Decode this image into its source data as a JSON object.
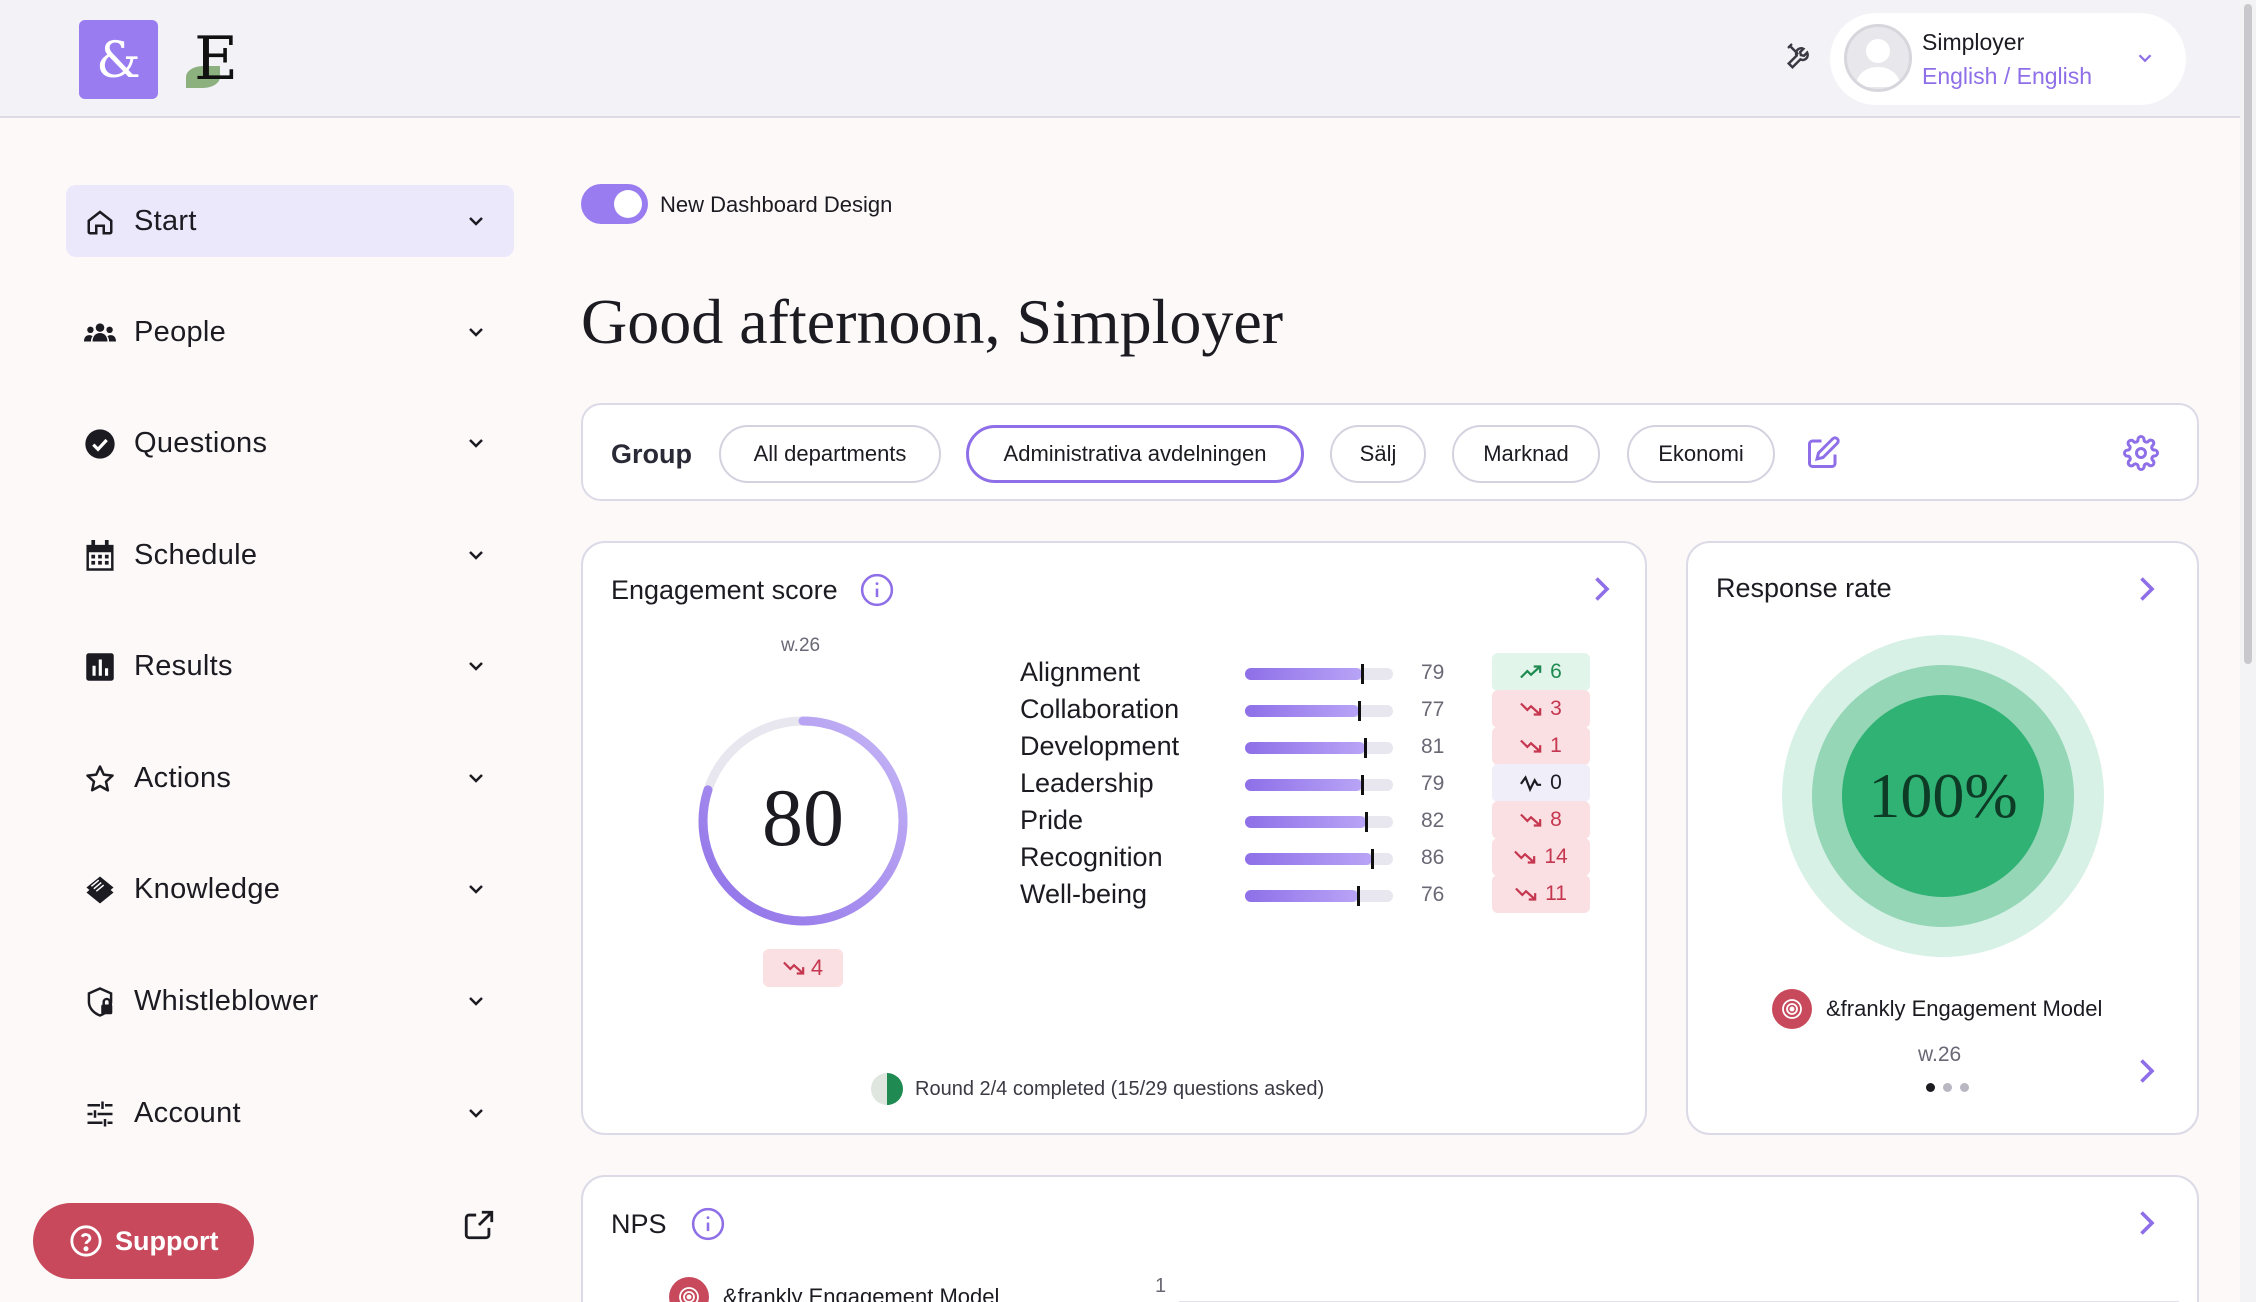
{
  "topbar": {
    "brand_logo": "&",
    "company_logo": "E",
    "user": {
      "name": "Simployer",
      "language": "English / English"
    }
  },
  "sidebar": {
    "items": [
      {
        "label": "Start",
        "icon": "home-icon"
      },
      {
        "label": "People",
        "icon": "people-icon"
      },
      {
        "label": "Questions",
        "icon": "check-circle-icon"
      },
      {
        "label": "Schedule",
        "icon": "calendar-icon"
      },
      {
        "label": "Results",
        "icon": "bar-chart-icon"
      },
      {
        "label": "Actions",
        "icon": "star-icon"
      },
      {
        "label": "Knowledge",
        "icon": "layers-icon"
      },
      {
        "label": "Whistleblower",
        "icon": "shield-lock-icon"
      },
      {
        "label": "Account",
        "icon": "sliders-icon"
      }
    ],
    "support_label": "Support"
  },
  "main": {
    "toggle_label": "New Dashboard Design",
    "toggle_on": true,
    "greeting": "Good afternoon, Simployer",
    "group": {
      "label": "Group",
      "chips": [
        "All departments",
        "Administrativa avdelningen",
        "Sälj",
        "Marknad",
        "Ekonomi"
      ],
      "selected": "Administrativa avdelningen"
    },
    "engagement": {
      "title": "Engagement score",
      "week": "w.26",
      "score": "80",
      "score_fraction": 0.8,
      "score_delta": "4",
      "metrics": [
        {
          "name": "Alignment",
          "value": "79",
          "delta": "6",
          "trend": "up"
        },
        {
          "name": "Collaboration",
          "value": "77",
          "delta": "3",
          "trend": "down"
        },
        {
          "name": "Development",
          "value": "81",
          "delta": "1",
          "trend": "down"
        },
        {
          "name": "Leadership",
          "value": "79",
          "delta": "0",
          "trend": "flat"
        },
        {
          "name": "Pride",
          "value": "82",
          "delta": "8",
          "trend": "down"
        },
        {
          "name": "Recognition",
          "value": "86",
          "delta": "14",
          "trend": "down"
        },
        {
          "name": "Well-being",
          "value": "76",
          "delta": "11",
          "trend": "down"
        }
      ],
      "round_status": "Round 2/4 completed (15/29 questions asked)"
    },
    "response_rate": {
      "title": "Response rate",
      "value": "100%",
      "model": "&frankly Engagement Model",
      "week": "w.26"
    },
    "nps": {
      "title": "NPS",
      "model": "&frankly Engagement Model",
      "axis_tick": "1"
    }
  },
  "colors": {
    "accent": "#9a7cf1",
    "support": "#c7495b",
    "positive": "#1f8a52",
    "negative": "#c5364f"
  }
}
